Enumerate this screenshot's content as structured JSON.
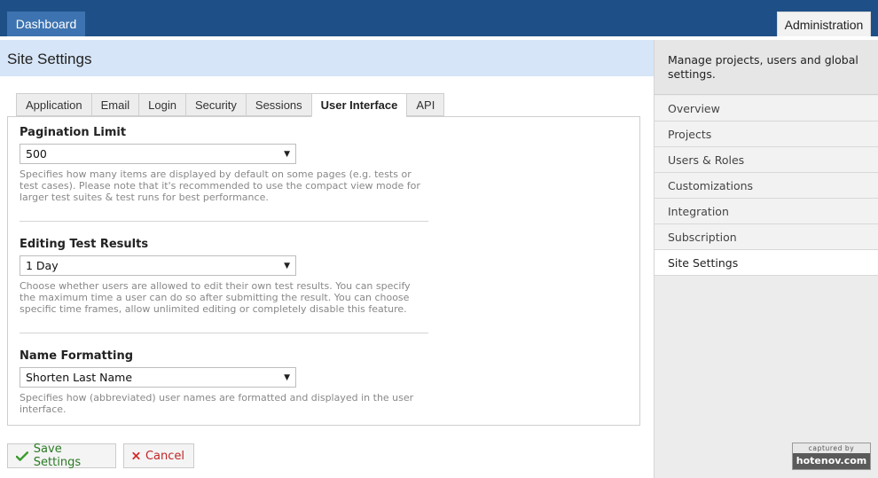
{
  "topbar": {
    "dashboard_label": "Dashboard",
    "administration_label": "Administration"
  },
  "page": {
    "title": "Site Settings"
  },
  "sidebar": {
    "description": "Manage projects, users and global settings.",
    "items": [
      {
        "label": "Overview",
        "active": false
      },
      {
        "label": "Projects",
        "active": false
      },
      {
        "label": "Users & Roles",
        "active": false
      },
      {
        "label": "Customizations",
        "active": false
      },
      {
        "label": "Integration",
        "active": false
      },
      {
        "label": "Subscription",
        "active": false
      },
      {
        "label": "Site Settings",
        "active": true
      }
    ]
  },
  "tabs": [
    {
      "label": "Application",
      "active": false
    },
    {
      "label": "Email",
      "active": false
    },
    {
      "label": "Login",
      "active": false
    },
    {
      "label": "Security",
      "active": false
    },
    {
      "label": "Sessions",
      "active": false
    },
    {
      "label": "User Interface",
      "active": true
    },
    {
      "label": "API",
      "active": false
    }
  ],
  "fields": {
    "pagination": {
      "label": "Pagination Limit",
      "value": "500",
      "help": "Specifies how many items are displayed by default on some pages (e.g. tests or test cases). Please note that it's recommended to use the compact view mode for larger test suites & test runs for best performance."
    },
    "editing": {
      "label": "Editing Test Results",
      "value": "1 Day",
      "help": "Choose whether users are allowed to edit their own test results. You can specify the maximum time a user can do so after submitting the result. You can choose specific time frames, allow unlimited editing or completely disable this feature."
    },
    "name_format": {
      "label": "Name Formatting",
      "value": "Shorten Last Name",
      "help": "Specifies how (abbreviated) user names are formatted and displayed in the user interface."
    }
  },
  "buttons": {
    "save_label": "Save Settings",
    "cancel_label": "Cancel"
  },
  "watermark": {
    "top": "captured by",
    "bottom": "hotenov.com"
  },
  "colors": {
    "topbar": "#1e4f86",
    "header_bg": "#d6e5f7",
    "save_green": "#2a7a23",
    "cancel_red": "#c02525"
  }
}
